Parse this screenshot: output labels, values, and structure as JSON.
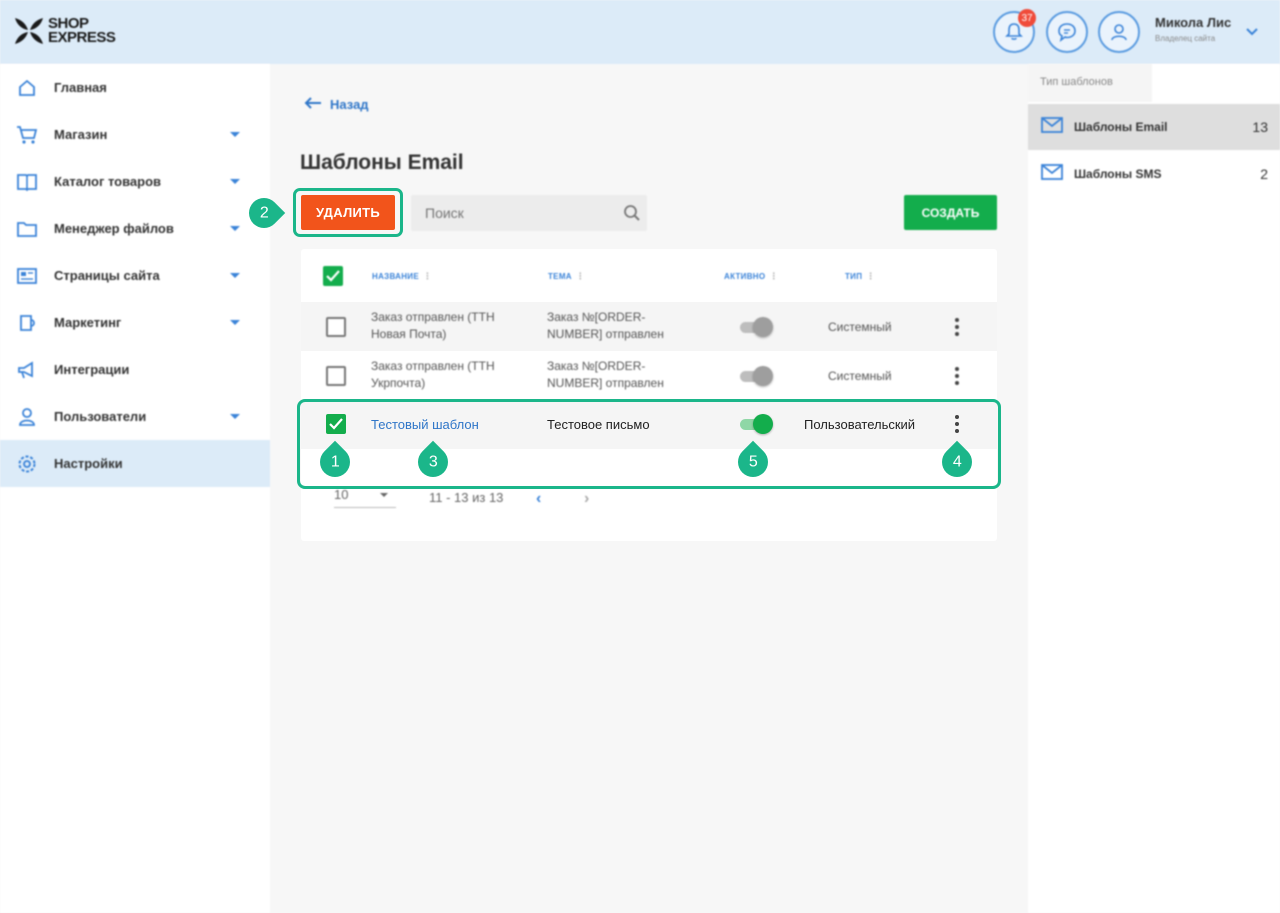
{
  "header": {
    "brand_line1": "SHOP",
    "brand_line2": "EXPRESS",
    "notifications_count": "37",
    "user_name": "Микола Лис",
    "user_role": "Владелец сайта"
  },
  "sidebar": {
    "items": [
      {
        "label": "Главная",
        "icon": "home-icon"
      },
      {
        "label": "Магазин",
        "icon": "cart-icon"
      },
      {
        "label": "Каталог товаров",
        "icon": "book-icon"
      },
      {
        "label": "Менеджер файлов",
        "icon": "folder-icon"
      },
      {
        "label": "Страницы сайта",
        "icon": "pages-icon"
      },
      {
        "label": "Маркетинг",
        "icon": "mug-icon"
      },
      {
        "label": "Интеграции",
        "icon": "megaphone-icon"
      },
      {
        "label": "Пользователи",
        "icon": "users-icon"
      },
      {
        "label": "Настройки",
        "icon": "gear-icon"
      }
    ]
  },
  "main": {
    "back_label": "Назад",
    "title": "Шаблоны Email",
    "delete_label": "УДАЛИТЬ",
    "search_placeholder": "Поиск",
    "create_label": "СОЗДАТЬ",
    "columns": [
      "НАЗВАНИЕ",
      "ТЕМА",
      "АКТИВНО",
      "ТИП"
    ],
    "rows": [
      {
        "name_line1": "Заказ отправлен (ТТН",
        "name_line2": "Новая Почта)",
        "subject_line1": "Заказ №[ORDER-",
        "subject_line2": "NUMBER] отправлен",
        "active": false,
        "type": "Системный",
        "checked": false
      },
      {
        "name_line1": "Заказ отправлен (ТТН",
        "name_line2": "Укрпочта)",
        "subject_line1": "Заказ №[ORDER-",
        "subject_line2": "NUMBER] отправлен",
        "active": false,
        "type": "Системный",
        "checked": false
      },
      {
        "name": "Тестовый шаблон",
        "subject": "Тестовое письмо",
        "active": true,
        "type": "Пользовательский",
        "checked": true
      }
    ],
    "per_page": "10",
    "range": "11 - 13 из 13"
  },
  "markers": [
    "1",
    "2",
    "3",
    "4",
    "5"
  ],
  "right_panel": {
    "tab": "Тип шаблонов",
    "items": [
      {
        "label": "Шаблоны Email",
        "count": "13"
      },
      {
        "label": "Шаблоны SMS",
        "count": "2"
      }
    ]
  },
  "colors": {
    "accent_blue": "#3a83d8",
    "delete_orange": "#f2541b",
    "create_green": "#13ad4c",
    "highlight_teal": "#1bb68a"
  }
}
